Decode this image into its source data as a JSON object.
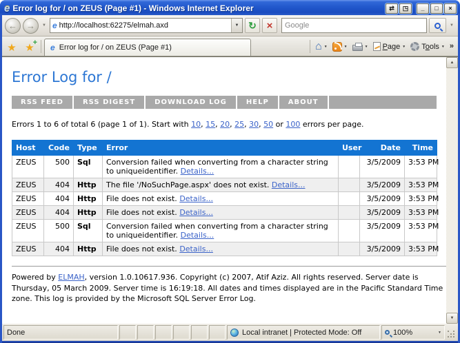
{
  "colors": {
    "accent_blue": "#1374d2",
    "nav_gray": "#a9a9a9",
    "heading_blue": "#2d77d4",
    "link_blue": "#3a62c8"
  },
  "chrome": {
    "window_title": "Error log for / on ZEUS (Page #1) - Windows Internet Explorer",
    "window_buttons": [
      {
        "name": "host-keys",
        "glyph": "⇄"
      },
      {
        "name": "popout",
        "glyph": "◳"
      },
      {
        "name": "minimize",
        "glyph": "_"
      },
      {
        "name": "maximize",
        "glyph": "□"
      },
      {
        "name": "close",
        "glyph": "×"
      }
    ],
    "address": "http://localhost:62275/elmah.axd",
    "search_placeholder": "Google",
    "tab_title": "Error log for / on ZEUS (Page #1)",
    "command_bar": {
      "page_key": "P",
      "page_rest": "age",
      "tools_pre": "T",
      "tools_key": "o",
      "tools_rest": "ols",
      "overflow": "»"
    },
    "status": {
      "done": "Done",
      "zone": "Local intranet | Protected Mode: Off",
      "zoom_level": "100%"
    }
  },
  "page": {
    "title": "Error Log for /",
    "nav_items": [
      "RSS FEED",
      "RSS DIGEST",
      "DOWNLOAD LOG",
      "HELP",
      "ABOUT"
    ],
    "pagination": {
      "prefix": "Errors 1 to 6 of total 6 (page 1 of 1). Start with ",
      "sizes": [
        "10",
        "15",
        "20",
        "25",
        "30",
        "50"
      ],
      "separator": ", ",
      "conjunction": " or ",
      "last_size": "100",
      "suffix": " errors per page."
    },
    "table": {
      "headers": [
        "Host",
        "Code",
        "Type",
        "Error",
        "User",
        "Date",
        "Time"
      ],
      "details_label": "Details...",
      "rows": [
        {
          "host": "ZEUS",
          "code": "500",
          "type": "Sql",
          "error": "Conversion failed when converting from a character string to uniqueidentifier.",
          "user": "",
          "date": "3/5/2009",
          "time": "3:53 PM"
        },
        {
          "host": "ZEUS",
          "code": "404",
          "type": "Http",
          "error": "The file '/NoSuchPage.aspx' does not exist.",
          "user": "",
          "date": "3/5/2009",
          "time": "3:53 PM"
        },
        {
          "host": "ZEUS",
          "code": "404",
          "type": "Http",
          "error": "File does not exist.",
          "user": "",
          "date": "3/5/2009",
          "time": "3:53 PM"
        },
        {
          "host": "ZEUS",
          "code": "404",
          "type": "Http",
          "error": "File does not exist.",
          "user": "",
          "date": "3/5/2009",
          "time": "3:53 PM"
        },
        {
          "host": "ZEUS",
          "code": "500",
          "type": "Sql",
          "error": "Conversion failed when converting from a character string to uniqueidentifier.",
          "user": "",
          "date": "3/5/2009",
          "time": "3:53 PM"
        },
        {
          "host": "ZEUS",
          "code": "404",
          "type": "Http",
          "error": "File does not exist.",
          "user": "",
          "date": "3/5/2009",
          "time": "3:53 PM"
        }
      ]
    },
    "footer": {
      "powered_prefix": "Powered by ",
      "elmah_link": "ELMAH",
      "text": ", version 1.0.10617.936. Copyright (c) 2007, Atif Aziz. All rights reserved. Server date is Thursday, 05 March 2009. Server time is 16:19:18. All dates and times displayed are in the Pacific Standard Time zone. This log is provided by the Microsoft SQL Server Error Log."
    }
  }
}
